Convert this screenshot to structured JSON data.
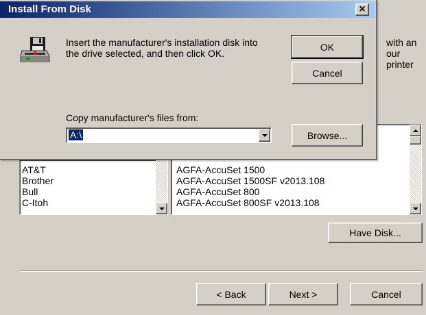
{
  "wizard": {
    "intro_line1": "with an",
    "intro_line2": "our printer",
    "manufacturers": [
      "AT&T",
      "Brother",
      "Bull",
      "C-Itoh"
    ],
    "printers": [
      "AGFA-AccuSet 1500",
      "AGFA-AccuSet 1500SF v2013.108",
      "AGFA-AccuSet 800",
      "AGFA-AccuSet 800SF v2013.108"
    ],
    "have_disk_label": "Have Disk...",
    "back_label": "< Back",
    "next_label": "Next >",
    "cancel_label": "Cancel"
  },
  "dialog": {
    "title": "Install From Disk",
    "close_glyph": "×",
    "message_line1": "Insert the manufacturer's installation disk into",
    "message_line2": "the drive selected, and then click OK.",
    "ok_label": "OK",
    "cancel_label": "Cancel",
    "copy_label": "Copy manufacturer's files from:",
    "path_value": "A:\\",
    "browse_label": "Browse..."
  },
  "colors": {
    "title_gradient_start": "#0a246a",
    "title_gradient_end": "#a6caf0",
    "face": "#d4d0c8"
  }
}
